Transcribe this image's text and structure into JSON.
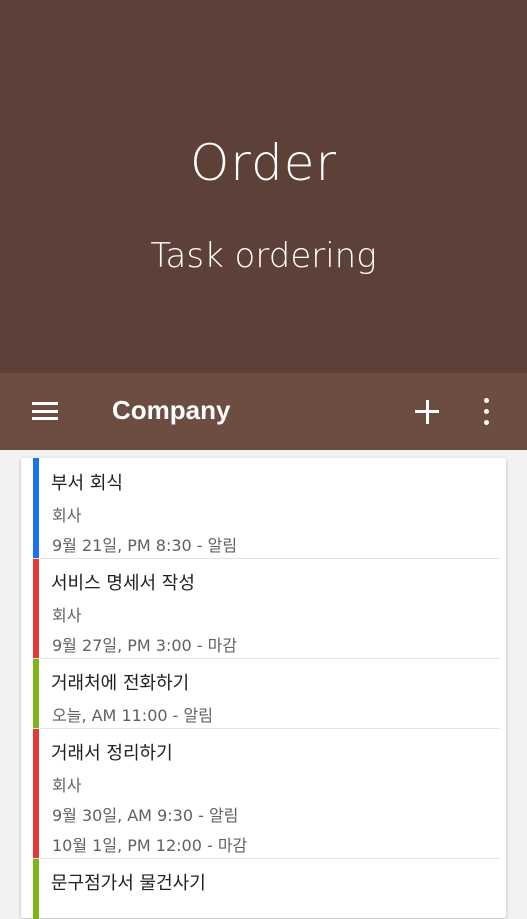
{
  "hero": {
    "title": "Order",
    "subtitle": "Task ordering",
    "background_color": "#5d4037"
  },
  "appbar": {
    "title": "Company",
    "menu_icon": "hamburger-menu-icon",
    "add_icon": "plus-icon",
    "more_icon": "more-vertical-icon",
    "background_color": "#6d4c41"
  },
  "tasks": [
    {
      "title": "부서 회식",
      "line1": "회사",
      "line2": "9월 21일, PM 8:30 - 알림",
      "line3": "",
      "color": "#1a73e8"
    },
    {
      "title": "서비스 명세서 작성",
      "line1": "회사",
      "line2": "9월 27일, PM 3:00 - 마감",
      "line3": "",
      "color": "#e53935"
    },
    {
      "title": "거래처에 전화하기",
      "line1": "오늘, AM 11:00 - 알림",
      "line2": "",
      "line3": "",
      "color": "#7cb518"
    },
    {
      "title": "거래서 정리하기",
      "line1": "회사",
      "line2": "9월 30일, AM 9:30 - 알림",
      "line3": "10월 1일, PM 12:00 - 마감",
      "color": "#e53935"
    },
    {
      "title": "문구점가서 물건사기",
      "line1": "",
      "line2": "",
      "line3": "",
      "color": "#7cb518"
    }
  ]
}
